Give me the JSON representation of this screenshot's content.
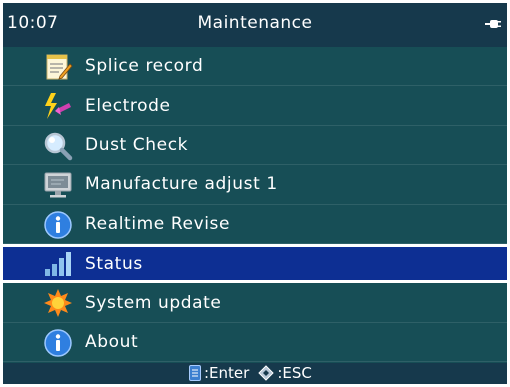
{
  "header": {
    "time": "10:07",
    "title": "Maintenance",
    "power_icon": "plug-icon"
  },
  "menu": {
    "items": [
      {
        "label": "Splice record",
        "icon": "notepad-pencil-icon"
      },
      {
        "label": "Electrode",
        "icon": "electrode-spark-icon"
      },
      {
        "label": "Dust Check",
        "icon": "magnifier-icon"
      },
      {
        "label": "Manufacture adjust 1",
        "icon": "monitor-icon"
      },
      {
        "label": "Realtime Revise",
        "icon": "info-icon"
      },
      {
        "label": "Status",
        "icon": "signal-bars-icon",
        "selected": true
      },
      {
        "label": "System update",
        "icon": "gear-sun-icon"
      },
      {
        "label": "About",
        "icon": "info-icon"
      }
    ]
  },
  "footer": {
    "enter_label": ":Enter",
    "esc_label": ":ESC"
  },
  "colors": {
    "background": "#174e56",
    "bar": "#16394c",
    "selected": "#0d2f93"
  }
}
